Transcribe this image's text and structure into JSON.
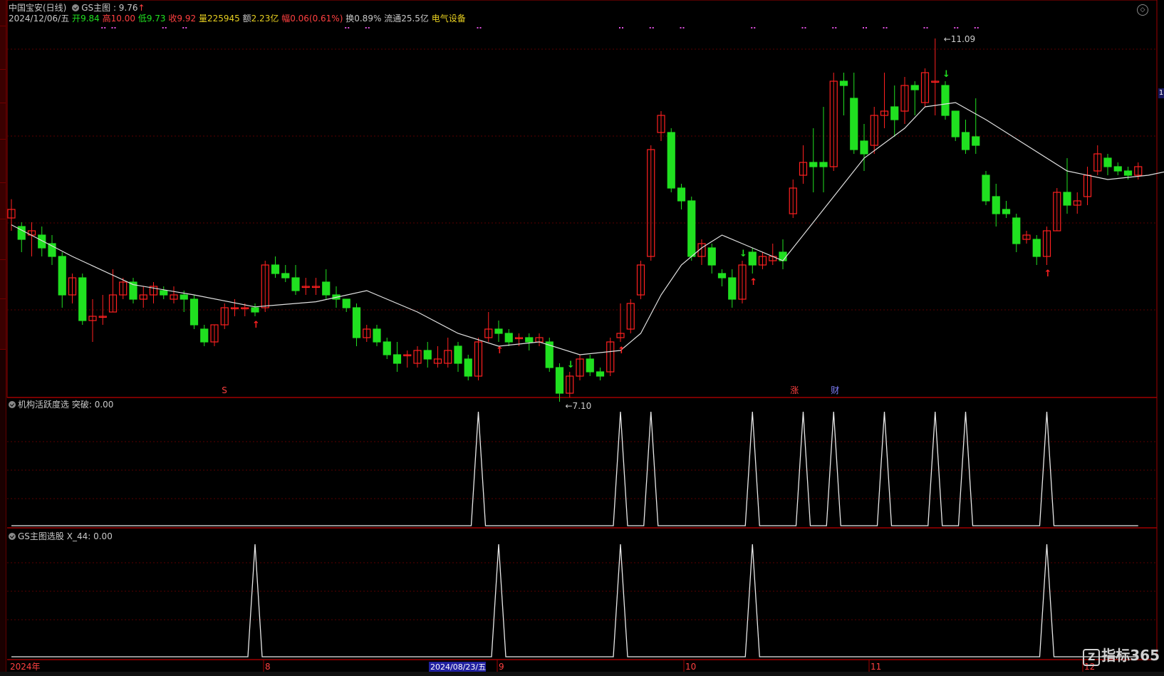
{
  "header": {
    "stock": "中国宝安(日线)",
    "indicator": "GS主图",
    "indicator_value": ": 9.76",
    "date": "2024/12/06/五",
    "open_label": "开",
    "open": "9.84",
    "high_label": "高",
    "high": "10.00",
    "low_label": "低",
    "low": "9.73",
    "close_label": "收",
    "close": "9.92",
    "vol_label": "量",
    "vol": "225945",
    "amt_label": "额",
    "amt": "2.23亿",
    "chg_label": "幅",
    "chg": "0.06(0.61%)",
    "turn_label": "换",
    "turn": "0.89%",
    "float_label": "流通",
    "float": "25.5亿",
    "sector": "电气设备"
  },
  "panel2": {
    "title": "机构活跃度选",
    "label": "突破",
    "value": ": 0.00"
  },
  "panel3": {
    "title": "GS主图选股",
    "label": "X_44",
    "value": ": 0.00"
  },
  "xaxis": {
    "year": "2024年",
    "selected_date": "2024/08/23/五",
    "months": [
      "8",
      "9",
      "10",
      "11",
      "12"
    ]
  },
  "annotations": {
    "high": "11.09",
    "low": "7.10",
    "markers": [
      "S",
      "涨",
      "财"
    ]
  },
  "right_marker": "1",
  "watermark": "指标365",
  "colors": {
    "up": "#ff2020",
    "down": "#20e020",
    "ma": "#e0e0e0",
    "grid": "#5a0000",
    "frame": "#a00000"
  },
  "chart_data": {
    "type": "candlestick",
    "ylim": [
      6.9,
      11.3
    ],
    "candles": [
      [
        9.0,
        9.1,
        8.85,
        9.22
      ],
      [
        8.9,
        8.75,
        8.6,
        8.95
      ],
      [
        8.8,
        8.85,
        8.55,
        8.95
      ],
      [
        8.8,
        8.65,
        8.55,
        8.9
      ],
      [
        8.7,
        8.55,
        8.45,
        8.8
      ],
      [
        8.55,
        8.1,
        7.95,
        8.6
      ],
      [
        8.1,
        8.3,
        8.0,
        8.35
      ],
      [
        8.3,
        7.8,
        7.75,
        8.35
      ],
      [
        7.8,
        7.85,
        7.55,
        8.05
      ],
      [
        7.85,
        7.85,
        7.75,
        8.1
      ],
      [
        7.9,
        8.1,
        7.9,
        8.4
      ],
      [
        8.1,
        8.25,
        8.05,
        8.3
      ],
      [
        8.25,
        8.05,
        8.0,
        8.3
      ],
      [
        8.05,
        8.1,
        7.95,
        8.2
      ],
      [
        8.1,
        8.2,
        8.0,
        8.25
      ],
      [
        8.15,
        8.1,
        8.05,
        8.2
      ],
      [
        8.05,
        8.1,
        8.0,
        8.2
      ],
      [
        8.1,
        8.05,
        7.9,
        8.15
      ],
      [
        8.05,
        7.75,
        7.7,
        8.1
      ],
      [
        7.7,
        7.55,
        7.5,
        7.75
      ],
      [
        7.55,
        7.75,
        7.5,
        7.75
      ],
      [
        7.75,
        7.95,
        7.7,
        8.0
      ],
      [
        7.95,
        7.95,
        7.85,
        8.05
      ],
      [
        7.95,
        7.95,
        7.85,
        8.0
      ],
      [
        7.95,
        7.9,
        7.85,
        8.0
      ],
      [
        7.95,
        8.45,
        7.9,
        8.5
      ],
      [
        8.45,
        8.35,
        8.3,
        8.55
      ],
      [
        8.35,
        8.3,
        8.25,
        8.45
      ],
      [
        8.3,
        8.15,
        8.1,
        8.45
      ],
      [
        8.2,
        8.2,
        8.1,
        8.3
      ],
      [
        8.2,
        8.2,
        8.1,
        8.3
      ],
      [
        8.25,
        8.1,
        8.05,
        8.4
      ],
      [
        8.1,
        8.05,
        7.95,
        8.2
      ],
      [
        8.05,
        7.95,
        7.9,
        8.05
      ],
      [
        7.95,
        7.6,
        7.5,
        8.0
      ],
      [
        7.6,
        7.7,
        7.55,
        7.75
      ],
      [
        7.7,
        7.55,
        7.5,
        7.75
      ],
      [
        7.55,
        7.4,
        7.35,
        7.6
      ],
      [
        7.4,
        7.3,
        7.2,
        7.55
      ],
      [
        7.4,
        7.4,
        7.25,
        7.45
      ],
      [
        7.3,
        7.45,
        7.25,
        7.5
      ],
      [
        7.45,
        7.35,
        7.25,
        7.55
      ],
      [
        7.3,
        7.35,
        7.25,
        7.5
      ],
      [
        7.3,
        7.45,
        7.25,
        7.6
      ],
      [
        7.5,
        7.3,
        7.2,
        7.55
      ],
      [
        7.35,
        7.15,
        7.1,
        7.4
      ],
      [
        7.15,
        7.55,
        7.1,
        7.6
      ],
      [
        7.6,
        7.7,
        7.55,
        7.9
      ],
      [
        7.7,
        7.65,
        7.55,
        7.8
      ],
      [
        7.65,
        7.55,
        7.5,
        7.7
      ],
      [
        7.6,
        7.6,
        7.5,
        7.65
      ],
      [
        7.6,
        7.55,
        7.45,
        7.65
      ],
      [
        7.55,
        7.6,
        7.5,
        7.65
      ],
      [
        7.55,
        7.25,
        7.2,
        7.6
      ],
      [
        7.25,
        6.95,
        6.85,
        7.3
      ],
      [
        6.95,
        7.15,
        6.9,
        7.2
      ],
      [
        7.15,
        7.35,
        7.1,
        7.4
      ],
      [
        7.35,
        7.2,
        7.15,
        7.4
      ],
      [
        7.2,
        7.15,
        7.1,
        7.25
      ],
      [
        7.2,
        7.55,
        7.15,
        7.6
      ],
      [
        7.6,
        7.65,
        7.55,
        8.0
      ],
      [
        7.7,
        8.0,
        7.65,
        8.05
      ],
      [
        8.1,
        8.45,
        8.05,
        8.5
      ],
      [
        8.55,
        9.8,
        8.5,
        9.85
      ],
      [
        10.0,
        10.2,
        9.9,
        10.25
      ],
      [
        10.0,
        9.35,
        9.3,
        10.05
      ],
      [
        9.35,
        9.2,
        9.1,
        9.4
      ],
      [
        9.2,
        8.55,
        8.5,
        9.25
      ],
      [
        8.55,
        8.7,
        8.45,
        8.75
      ],
      [
        8.65,
        8.45,
        8.35,
        8.7
      ],
      [
        8.35,
        8.3,
        8.2,
        8.4
      ],
      [
        8.3,
        8.05,
        7.95,
        8.4
      ],
      [
        8.05,
        8.45,
        8.0,
        8.5
      ],
      [
        8.6,
        8.45,
        8.35,
        8.65
      ],
      [
        8.45,
        8.55,
        8.4,
        8.6
      ],
      [
        8.5,
        8.55,
        8.45,
        8.7
      ],
      [
        8.6,
        8.5,
        8.4,
        8.75
      ],
      [
        9.05,
        9.35,
        9.0,
        9.45
      ],
      [
        9.5,
        9.65,
        9.4,
        9.85
      ],
      [
        9.65,
        9.6,
        9.3,
        10.05
      ],
      [
        9.65,
        9.6,
        9.3,
        10.3
      ],
      [
        9.6,
        10.6,
        9.55,
        10.7
      ],
      [
        10.6,
        10.55,
        10.2,
        10.7
      ],
      [
        10.4,
        9.8,
        9.75,
        10.7
      ],
      [
        9.9,
        9.75,
        9.55,
        10.1
      ],
      [
        9.85,
        10.2,
        9.75,
        10.3
      ],
      [
        10.2,
        10.25,
        10.05,
        10.7
      ],
      [
        10.3,
        10.15,
        9.95,
        10.55
      ],
      [
        10.25,
        10.55,
        10.1,
        10.65
      ],
      [
        10.55,
        10.5,
        10.2,
        10.6
      ],
      [
        10.35,
        10.7,
        10.3,
        10.75
      ],
      [
        10.6,
        10.6,
        10.2,
        11.1
      ],
      [
        10.55,
        10.2,
        10.15,
        10.6
      ],
      [
        10.25,
        9.95,
        9.9,
        10.25
      ],
      [
        10.0,
        9.8,
        9.75,
        10.15
      ],
      [
        9.95,
        9.85,
        9.75,
        10.4
      ],
      [
        9.5,
        9.2,
        9.15,
        9.55
      ],
      [
        9.25,
        9.05,
        8.9,
        9.4
      ],
      [
        9.1,
        9.05,
        9.0,
        9.2
      ],
      [
        9.0,
        8.7,
        8.6,
        9.05
      ],
      [
        8.75,
        8.8,
        8.7,
        8.85
      ],
      [
        8.75,
        8.55,
        8.45,
        8.8
      ],
      [
        8.55,
        8.85,
        8.45,
        8.9
      ],
      [
        8.85,
        9.3,
        8.85,
        9.35
      ],
      [
        9.3,
        9.15,
        9.05,
        9.7
      ],
      [
        9.15,
        9.2,
        9.05,
        9.3
      ],
      [
        9.25,
        9.5,
        9.15,
        9.6
      ],
      [
        9.55,
        9.75,
        9.5,
        9.85
      ],
      [
        9.7,
        9.6,
        9.5,
        9.75
      ],
      [
        9.6,
        9.55,
        9.5,
        9.65
      ],
      [
        9.55,
        9.5,
        9.45,
        9.6
      ],
      [
        9.5,
        9.6,
        9.45,
        9.65
      ]
    ],
    "ma": [
      [
        0,
        8.92
      ],
      [
        6,
        8.55
      ],
      [
        12,
        8.22
      ],
      [
        18,
        8.1
      ],
      [
        24,
        7.96
      ],
      [
        30,
        8.02
      ],
      [
        35,
        8.15
      ],
      [
        40,
        7.9
      ],
      [
        44,
        7.65
      ],
      [
        48,
        7.5
      ],
      [
        52,
        7.55
      ],
      [
        56,
        7.4
      ],
      [
        60,
        7.45
      ],
      [
        62,
        7.65
      ],
      [
        64,
        8.1
      ],
      [
        66,
        8.45
      ],
      [
        68,
        8.65
      ],
      [
        70,
        8.8
      ],
      [
        72,
        8.7
      ],
      [
        76,
        8.5
      ],
      [
        80,
        9.1
      ],
      [
        84,
        9.7
      ],
      [
        88,
        10.05
      ],
      [
        90,
        10.3
      ],
      [
        93,
        10.35
      ],
      [
        96,
        10.15
      ],
      [
        100,
        9.85
      ],
      [
        104,
        9.55
      ],
      [
        108,
        9.45
      ],
      [
        112,
        9.5
      ],
      [
        116,
        9.6
      ]
    ],
    "spikes1": [
      46,
      60,
      63,
      73,
      78,
      81,
      86,
      91,
      94,
      102
    ],
    "spikes3": [
      24,
      48,
      60,
      73,
      102
    ]
  }
}
